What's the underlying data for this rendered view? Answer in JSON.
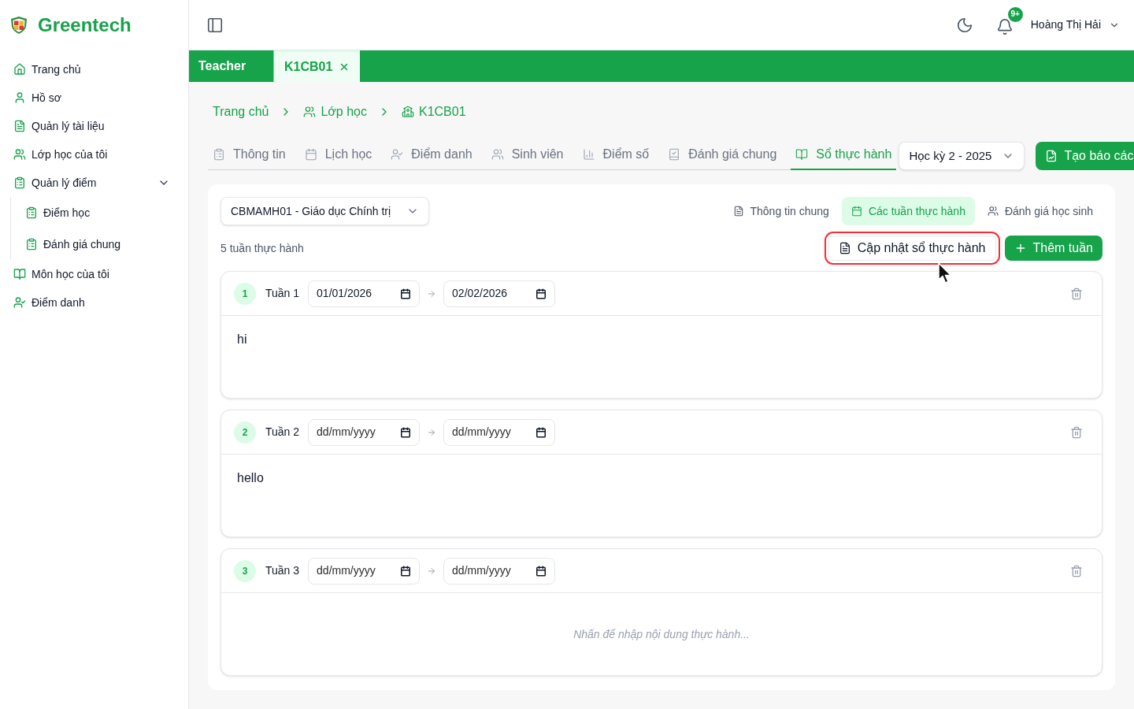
{
  "sidebar": {
    "brand": "Greentech",
    "items": [
      {
        "label": "Trang chủ"
      },
      {
        "label": "Hồ sơ"
      },
      {
        "label": "Quản lý tài liệu"
      },
      {
        "label": "Lớp học của tôi"
      },
      {
        "label": "Quản lý điểm",
        "expanded": true,
        "children": [
          {
            "label": "Điểm học"
          },
          {
            "label": "Đánh giá chung"
          }
        ]
      },
      {
        "label": "Môn học của tôi"
      },
      {
        "label": "Điểm danh"
      }
    ]
  },
  "header": {
    "notification_badge": "9+",
    "user_name": "Hoàng Thị Hải"
  },
  "open_tabs": [
    {
      "label": "Teacher",
      "selected": false,
      "closable": false
    },
    {
      "label": "K1CB01",
      "selected": true,
      "closable": true
    }
  ],
  "breadcrumb": [
    "Trang chủ",
    "Lớp học",
    "K1CB01"
  ],
  "class_tabs": [
    {
      "label": "Thông tin",
      "selected": false
    },
    {
      "label": "Lịch học",
      "selected": false
    },
    {
      "label": "Điểm danh",
      "selected": false
    },
    {
      "label": "Sinh viên",
      "selected": false
    },
    {
      "label": "Điểm số",
      "selected": false
    },
    {
      "label": "Đánh giá chung",
      "selected": false
    },
    {
      "label": "Sổ thực hành",
      "selected": true
    }
  ],
  "term_select": {
    "value": "Học kỳ 2 - 2025"
  },
  "report_button": "Tạo báo các",
  "practice": {
    "subject_select": {
      "value": "CBMAMH01 - Giáo dục Chính trị"
    },
    "view_tabs": [
      {
        "label": "Thông tin chung",
        "selected": false
      },
      {
        "label": "Các tuần thực hành",
        "selected": true
      },
      {
        "label": "Đánh giá học sinh",
        "selected": false
      }
    ],
    "week_count": "5 tuần thực hành",
    "update_button": {
      "label": "Cập nhật sổ thực hành",
      "focused": true
    },
    "add_button": "Thêm tuần",
    "weeks": [
      {
        "number": "1",
        "label": "Tuần 1",
        "start": {
          "value": "01/01/2026"
        },
        "end": {
          "value": "02/02/2026"
        },
        "content": {
          "value": "hi"
        }
      },
      {
        "number": "2",
        "label": "Tuần 2",
        "start": {
          "placeholder": "dd/mm/yyyy"
        },
        "end": {
          "placeholder": "dd/mm/yyyy"
        },
        "content": {
          "value": "hello"
        }
      },
      {
        "number": "3",
        "label": "Tuần 3",
        "start": {
          "placeholder": "dd/mm/yyyy"
        },
        "end": {
          "placeholder": "dd/mm/yyyy"
        },
        "content": {
          "placeholder": "Nhấn để nhập nội dung thực hành..."
        }
      }
    ]
  }
}
